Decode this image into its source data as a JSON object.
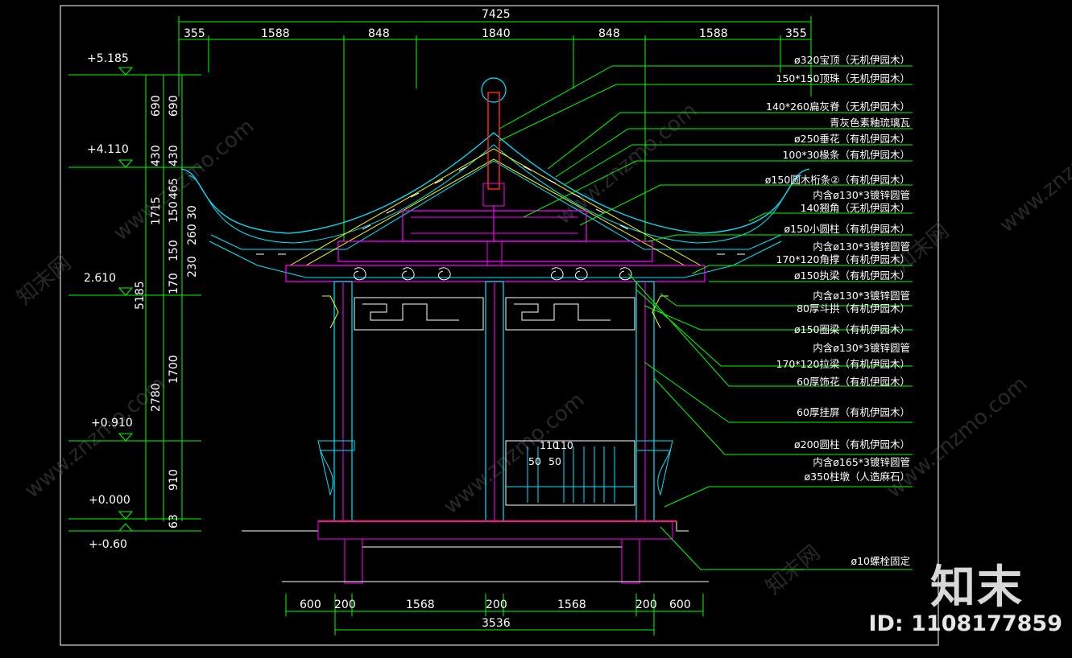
{
  "drawing": {
    "total_width": "7425",
    "top_dims": [
      "355",
      "1588",
      "848",
      "1840",
      "848",
      "1588",
      "355"
    ],
    "bottom_dims": [
      "600",
      "200",
      "1568",
      "200",
      "1568",
      "200",
      "600"
    ],
    "bottom_total": "3536",
    "levels": [
      "+5.185",
      "+4.110",
      "2.610",
      "+0.910",
      "+0.000",
      "+-0.60"
    ],
    "left_dims_outer": [
      "690",
      "430",
      "1715",
      "2780",
      "5185",
      "910",
      "63"
    ],
    "left_dims_inner": [
      "690",
      "430",
      "465",
      "150",
      "30",
      "260",
      "150",
      "230",
      "170",
      "1700"
    ],
    "bench_dims": [
      "110",
      "110",
      "50",
      "50"
    ],
    "annotations": [
      "ø320宝顶（无机伊园木）",
      "150*150顶珠（无机伊园木）",
      "140*260扁灰脊（无机伊园木）",
      "青灰色素釉琉璃瓦",
      "ø250垂花（有机伊园木）",
      "100*30椽条（有机伊园木）",
      "ø150圆木桁条②（有机伊园木）",
      "内含ø130*3镀锌圆管",
      "140翘角（无机伊园木）",
      "ø150小圆柱（有机伊园木）",
      "内含ø130*3镀锌圆管",
      "170*120角撑（有机伊园木）",
      "ø150执梁（有机伊园木）",
      "内含ø130*3镀锌圆管",
      "80厚斗拱（有机伊园木）",
      "ø150圈梁（有机伊园木）",
      "内含ø130*3镀锌圆管",
      "170*120拉梁（有机伊园木）",
      "60厚饰花（有机伊园木）",
      "60厚挂屏（有机伊园木）",
      "ø200圆柱（有机伊园木）",
      "内含ø165*3镀锌圆管",
      "ø350柱墩（人造麻石）",
      "ø10螺栓固定"
    ]
  },
  "watermarks": [
    "www.znzmo.com",
    "知末网"
  ],
  "brand": "知末",
  "id_label": "ID: 1108177859",
  "colors": {
    "dim_line": "#00ff00",
    "roof": "#00e5ff",
    "structure": "#ff00ff",
    "rafter": "#ffff00",
    "frame": "#ffffff",
    "accent_red": "#ff2020"
  }
}
